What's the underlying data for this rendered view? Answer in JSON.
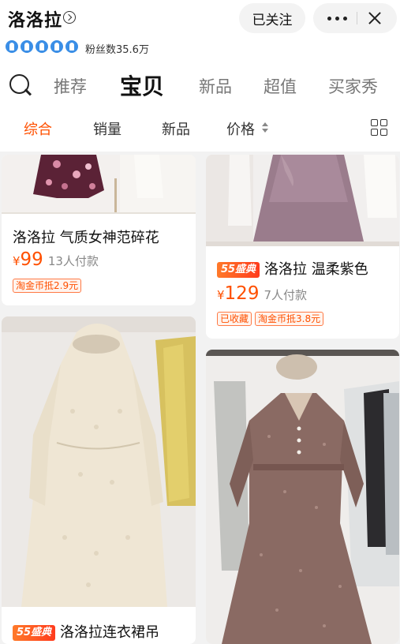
{
  "header": {
    "shop_name": "洛洛拉",
    "follow_label": "已关注",
    "fans_text": "粉丝数35.6万"
  },
  "tabs": [
    "推荐",
    "宝贝",
    "新品",
    "超值",
    "买家秀"
  ],
  "active_tab": "宝贝",
  "subtabs": [
    "综合",
    "销量",
    "新品",
    "价格"
  ],
  "active_subtab": "综合",
  "colors": {
    "accent": "#ff5000"
  },
  "products": [
    {
      "title": "洛洛拉 气质女神范碎花",
      "currency": "¥",
      "price": "99",
      "sold": "13人付款",
      "coupons": [
        "淘金币抵2.9元"
      ]
    },
    {
      "badge": "55盛典",
      "title": "洛洛拉 温柔紫色",
      "currency": "¥",
      "price": "129",
      "sold": "7人付款",
      "coupons": [
        "已收藏",
        "淘金币抵3.8元"
      ]
    },
    {
      "badge": "55盛典",
      "title": "洛洛拉连衣裙吊"
    },
    {}
  ]
}
